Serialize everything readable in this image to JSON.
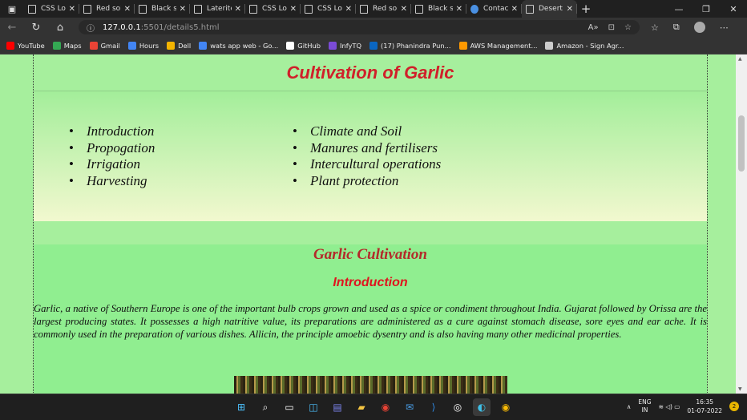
{
  "browser": {
    "tabs": [
      {
        "title": "CSS Log",
        "active": false
      },
      {
        "title": "Red soil",
        "active": false
      },
      {
        "title": "Black so",
        "active": false
      },
      {
        "title": "Laterite",
        "active": false
      },
      {
        "title": "CSS Log",
        "active": false
      },
      {
        "title": "CSS Log",
        "active": false
      },
      {
        "title": "Red soil",
        "active": false
      },
      {
        "title": "Black so",
        "active": false
      },
      {
        "title": "Contact",
        "active": false
      },
      {
        "title": "Desert s",
        "active": true
      }
    ],
    "url_host": "127.0.0.1",
    "url_path": ":5501/details5.html",
    "bookmarks": [
      {
        "label": "YouTube",
        "color": "#ff0000"
      },
      {
        "label": "Maps",
        "color": "#34a853"
      },
      {
        "label": "Gmail",
        "color": "#ea4335"
      },
      {
        "label": "Hours",
        "color": "#4285f4"
      },
      {
        "label": "Dell",
        "color": "#f4b400"
      },
      {
        "label": "wats app web - Go...",
        "color": "#4285f4"
      },
      {
        "label": "GitHub",
        "color": "#ffffff"
      },
      {
        "label": "InfyTQ",
        "color": "#7b4bd6"
      },
      {
        "label": "(17) Phanindra Pun...",
        "color": "#0a66c2"
      },
      {
        "label": "AWS Management...",
        "color": "#ff9900"
      },
      {
        "label": "Amazon - Sign Agr...",
        "color": "#cccccc"
      }
    ]
  },
  "page": {
    "title": "Cultivation of Garlic",
    "toc_left": [
      "Introduction",
      "Propogation",
      "Irrigation",
      "Harvesting"
    ],
    "toc_right": [
      "Climate and Soil",
      "Manures and fertilisers",
      "Intercultural operations",
      "Plant protection"
    ],
    "section_heading": "Garlic Cultivation",
    "sub_heading": "Introduction",
    "paragraph": "Garlic, a native of Southern Europe is one of the important bulb crops grown and used as a spice or condiment throughout India. Gujarat followed by Orissa are the largest producing states. It possesses a high natritive value, its preparations are administered as a cure against stomach disease, sore eyes and ear ache. It is commonly used in the preparation of various dishes. Allicin, the principle amoebic dysentry and is also having many other medicinal properties."
  },
  "taskbar": {
    "lang_line1": "ENG",
    "lang_line2": "IN",
    "time": "16:35",
    "date": "01-07-2022",
    "notifications": "2"
  },
  "colors": {
    "page_bg": "#a6ef9d",
    "title_red": "#d0202a",
    "heading_brown": "#b32a2a"
  }
}
